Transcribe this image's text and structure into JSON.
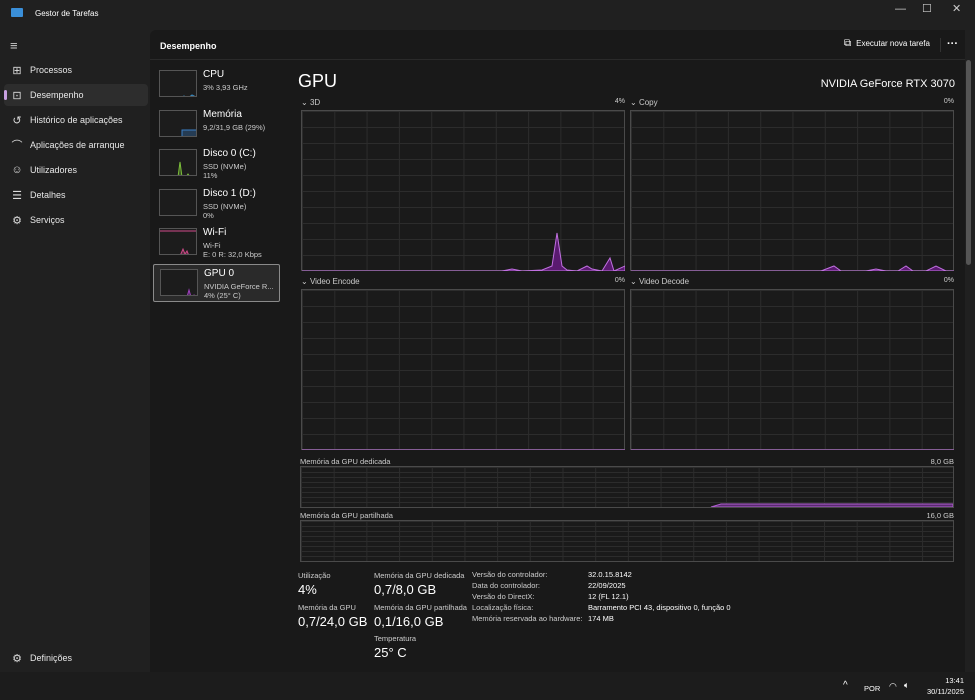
{
  "app": {
    "title": "Gestor de Tarefas",
    "window_controls": [
      "minimize",
      "maximize",
      "close"
    ]
  },
  "sidebar": {
    "items": [
      {
        "label": "Processos",
        "icon": "processes-icon"
      },
      {
        "label": "Desempenho",
        "icon": "performance-icon",
        "selected": true
      },
      {
        "label": "Histórico de aplicações",
        "icon": "history-icon"
      },
      {
        "label": "Aplicações de arranque",
        "icon": "startup-icon"
      },
      {
        "label": "Utilizadores",
        "icon": "users-icon"
      },
      {
        "label": "Detalhes",
        "icon": "details-icon"
      },
      {
        "label": "Serviços",
        "icon": "services-icon"
      }
    ],
    "settings": "Definições"
  },
  "header": {
    "title": "Desempenho",
    "run_task": "Executar nova tarefa",
    "more": "···"
  },
  "devices": [
    {
      "title": "CPU",
      "line1": "3% 3,93 GHz",
      "line2": "",
      "color": "#3a8fc7"
    },
    {
      "title": "Memória",
      "line1": "9,2/31,9 GB (29%)",
      "line2": "",
      "color": "#3a7fc7"
    },
    {
      "title": "Disco 0 (C:)",
      "line1": "SSD (NVMe)",
      "line2": "11%",
      "color": "#7cbf3a"
    },
    {
      "title": "Disco 1 (D:)",
      "line1": "SSD (NVMe)",
      "line2": "0%",
      "color": "#7cbf3a"
    },
    {
      "title": "Wi-Fi",
      "line1": "Wi-Fi",
      "line2": "E: 0 R: 32,0 Kbps",
      "color": "#d04a8a"
    },
    {
      "title": "GPU 0",
      "line1": "NVIDIA GeForce R...",
      "line2": "4% (25° C)",
      "color": "#a040c0",
      "selected": true
    }
  ],
  "gpu": {
    "title": "GPU",
    "name": "NVIDIA GeForce RTX 3070",
    "accent": "#a040c0",
    "engines": [
      {
        "label": "3D",
        "value": "4%"
      },
      {
        "label": "Copy",
        "value": "0%"
      },
      {
        "label": "Video Encode",
        "value": "0%"
      },
      {
        "label": "Video Decode",
        "value": "0%"
      }
    ],
    "dedicated": {
      "label": "Memória da GPU dedicada",
      "max": "8,0 GB"
    },
    "shared": {
      "label": "Memória da GPU partilhada",
      "max": "16,0 GB"
    },
    "stats": {
      "util_label": "Utilização",
      "util": "4%",
      "mem_label": "Memória da GPU",
      "mem": "0,7/24,0 GB",
      "ded_label": "Memória da GPU dedicada",
      "ded": "0,7/8,0 GB",
      "sh_label": "Memória da GPU partilhada",
      "sh": "0,1/16,0 GB",
      "temp_label": "Temperatura",
      "temp": "25° C"
    },
    "info": [
      {
        "k": "Versão do controlador:",
        "v": "32.0.15.8142"
      },
      {
        "k": "Data do controlador:",
        "v": "22/09/2025"
      },
      {
        "k": "Versão do DirectX:",
        "v": "12 (FL 12.1)"
      },
      {
        "k": "Localização física:",
        "v": "Barramento PCI 43, dispositivo 0, função 0"
      },
      {
        "k": "Memória reservada ao hardware:",
        "v": "174 MB"
      }
    ]
  },
  "taskbar": {
    "lang": "POR",
    "time": "13:41",
    "date": "30/11/2025"
  }
}
